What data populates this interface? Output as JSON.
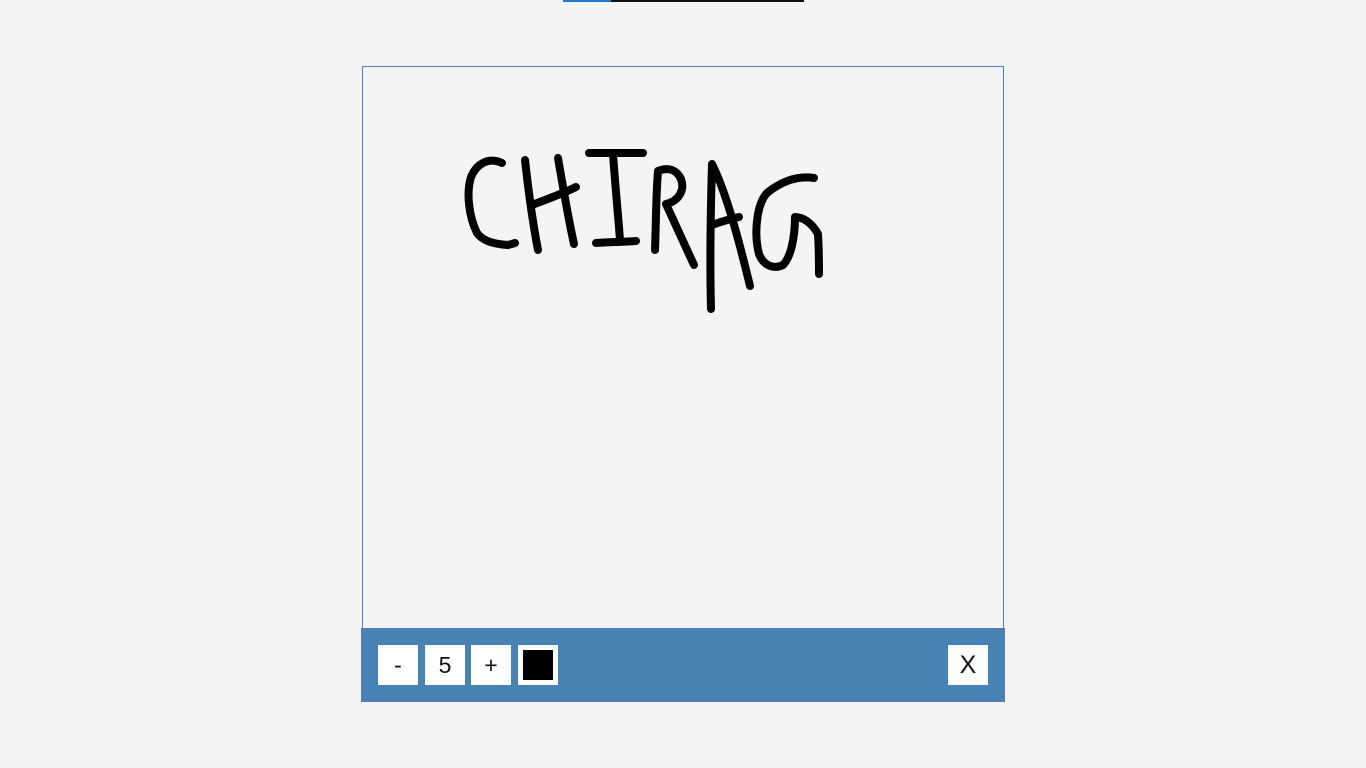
{
  "progress": {
    "value_percent": 20,
    "track_color": "#111111",
    "fill_color": "#1e7bd0"
  },
  "canvas": {
    "background": "#f4f4f4",
    "border_color": "#4a84c4",
    "handwritten_text": "CHIRAG",
    "stroke_color": "#000000"
  },
  "toolbar": {
    "background": "#4682b4",
    "decrease_label": "-",
    "brush_size": "5",
    "increase_label": "+",
    "current_color": "#000000",
    "close_label": "X"
  }
}
